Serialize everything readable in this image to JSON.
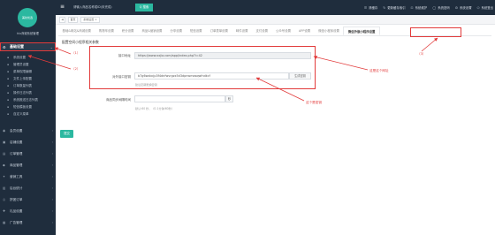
{
  "sidebar": {
    "brand": "hlx商城系统管理",
    "logo_text": "美妆优选",
    "active": {
      "icon": "gear-icon",
      "label": "基础设置"
    },
    "sub_items": [
      {
        "icon": "dot-icon",
        "label": "系统设置"
      },
      {
        "icon": "dot-icon",
        "label": "管理员设置"
      },
      {
        "icon": "dot-icon",
        "label": "菜单权限编辑"
      },
      {
        "icon": "dot-icon",
        "label": "文件上传配置"
      },
      {
        "icon": "dot-icon",
        "label": "订单数量列表"
      },
      {
        "icon": "dot-icon",
        "label": "操作日志列表"
      },
      {
        "icon": "dot-icon",
        "label": "系统推送日志列表"
      },
      {
        "icon": "dot-icon",
        "label": "短信模板设置"
      },
      {
        "icon": "dot-icon",
        "label": "自定义菜单"
      }
    ],
    "items": [
      {
        "icon": "users-icon",
        "label": "会员设置"
      },
      {
        "icon": "shop-icon",
        "label": "店铺设置"
      },
      {
        "icon": "box-icon",
        "label": "订单管理"
      },
      {
        "icon": "tag-icon",
        "label": "商品管理"
      },
      {
        "icon": "tool-icon",
        "label": "营销工具"
      },
      {
        "icon": "chart-icon",
        "label": "后台统计"
      },
      {
        "icon": "group-icon",
        "label": "拼团订单"
      },
      {
        "icon": "gift-icon",
        "label": "礼品设置"
      },
      {
        "icon": "ad-icon",
        "label": "广告管理"
      }
    ]
  },
  "topbar": {
    "search_text": "请输入商品名称或ID(未完成)",
    "search_button": "Q 搜索",
    "links": [
      {
        "icon": "clear-icon",
        "label": "清缓存"
      },
      {
        "icon": "refresh-icon",
        "label": "更新缓存索引"
      },
      {
        "icon": "lock-icon",
        "label": "系统维护"
      },
      {
        "icon": "user-icon",
        "label": "系统密码"
      },
      {
        "icon": "setting-icon",
        "label": "系统设置"
      },
      {
        "icon": "power-icon",
        "label": "系统登出"
      }
    ]
  },
  "breadcrumb": {
    "nav": "◀",
    "home": "首页",
    "tab": "系统设置 ×"
  },
  "tabs": [
    "基础&网站&商城设置",
    "购物车设置",
    "积分设置",
    "商品&营销设置",
    "分享设置",
    "短信设置",
    "订单表单设置",
    "邮件设置",
    "支付设置",
    "公众号设置",
    "APP设置",
    "微信小程序设置"
  ],
  "active_tab": "微信外嵌小程序设置",
  "section_title": "配置空间小程序相关参数",
  "form": {
    "url_label": "接口地址",
    "url_value": "https://www.xxjia.com/app/index.php?i=42",
    "token_label": "对外接口密钥",
    "token_value": "b7g6wxbcjp3f4dnfwvrgzx5d3dpnwmasqwfndkcf",
    "token_button": "生成密钥",
    "token_hint": "建议定期更换密钥",
    "sync_label": "商品同步间隔时间",
    "sync_unit": "秒",
    "sync_hint": "默认:60 秒，（0-1分钟/60秒）"
  },
  "annotations": {
    "one": "（1）",
    "two": "（2）",
    "three": "（3）",
    "copy_note": "这是这个网址",
    "key_note": "这个是密钥"
  },
  "submit_label": "提交",
  "colors": {
    "sidebar_bg": "#1f2d3d",
    "accent": "#2bb8a0",
    "annotation": "#e23b3b"
  }
}
